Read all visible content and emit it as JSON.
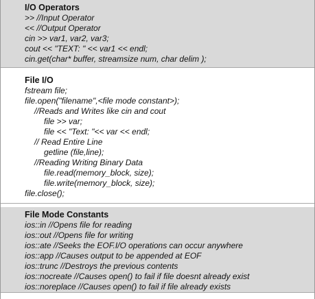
{
  "io_operators": {
    "title": "I/O Operators",
    "lines": [
      ">> //Input Operator",
      "<< //Output Operator",
      "cin >> var1, var2, var3;",
      "cout << \"TEXT: \" << var1 << endl;",
      "cin.get(char* buffer, streamsize num, char delim );"
    ]
  },
  "file_io": {
    "title": "File I/O",
    "lines": [
      "fstream  file;",
      "file.open(\"filename\",<file mode constant>);",
      "//Reads and Writes like cin and cout",
      "file >> var;",
      "file << \"Text: \"<< var << endl;",
      "// Read Entire Line",
      "getline (file,line);",
      "//Reading Writing Binary Data",
      "file.read(memory_block, size);",
      "file.write(memory_block, size);",
      "file.close();"
    ]
  },
  "file_mode_constants": {
    "title": "File Mode Constants",
    "lines": [
      "ios::in  //Opens file for reading",
      "ios::out  //Opens file for writing",
      "ios::ate  //Seeks the EOF.I/O operations can occur anywhere",
      "ios::app  //Causes output to be appended at EOF",
      "ios::trunc  //Destroys the previous contents",
      "ios::nocreate  //Causes open() to fail if file doesnt already exist",
      "ios::noreplace  //Causes open() to fail if file already exists"
    ]
  }
}
